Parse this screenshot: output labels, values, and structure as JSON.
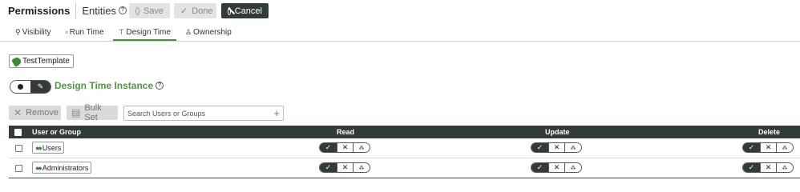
{
  "header": {
    "title": "Permissions",
    "entity": "Entities",
    "dirty_marker": "*",
    "help_glyph": "?",
    "buttons": {
      "save": "Save",
      "done": "Done",
      "cancel": "Cancel"
    }
  },
  "tabs": [
    {
      "label": "Visibility",
      "icon": "visibility-icon"
    },
    {
      "label": "Run Time",
      "icon": "run-time-icon"
    },
    {
      "label": "Design Time",
      "icon": "design-time-icon",
      "active": true
    },
    {
      "label": "Ownership",
      "icon": "ownership-icon"
    }
  ],
  "template": {
    "label": "TestTemplate"
  },
  "section": {
    "title": "Design Time Instance"
  },
  "toolbar": {
    "remove": "Remove",
    "bulk_set": "Bulk Set",
    "search_placeholder": "Search Users or Groups"
  },
  "table": {
    "columns": {
      "user_or_group": "User or Group",
      "read": "Read",
      "update": "Update",
      "delete": "Delete"
    },
    "rows": [
      {
        "name": "Users"
      },
      {
        "name": "Administrators"
      }
    ]
  },
  "colors": {
    "accent": "#4a9a3e",
    "dark": "#333b36",
    "disabled": "#e3e3e3"
  }
}
